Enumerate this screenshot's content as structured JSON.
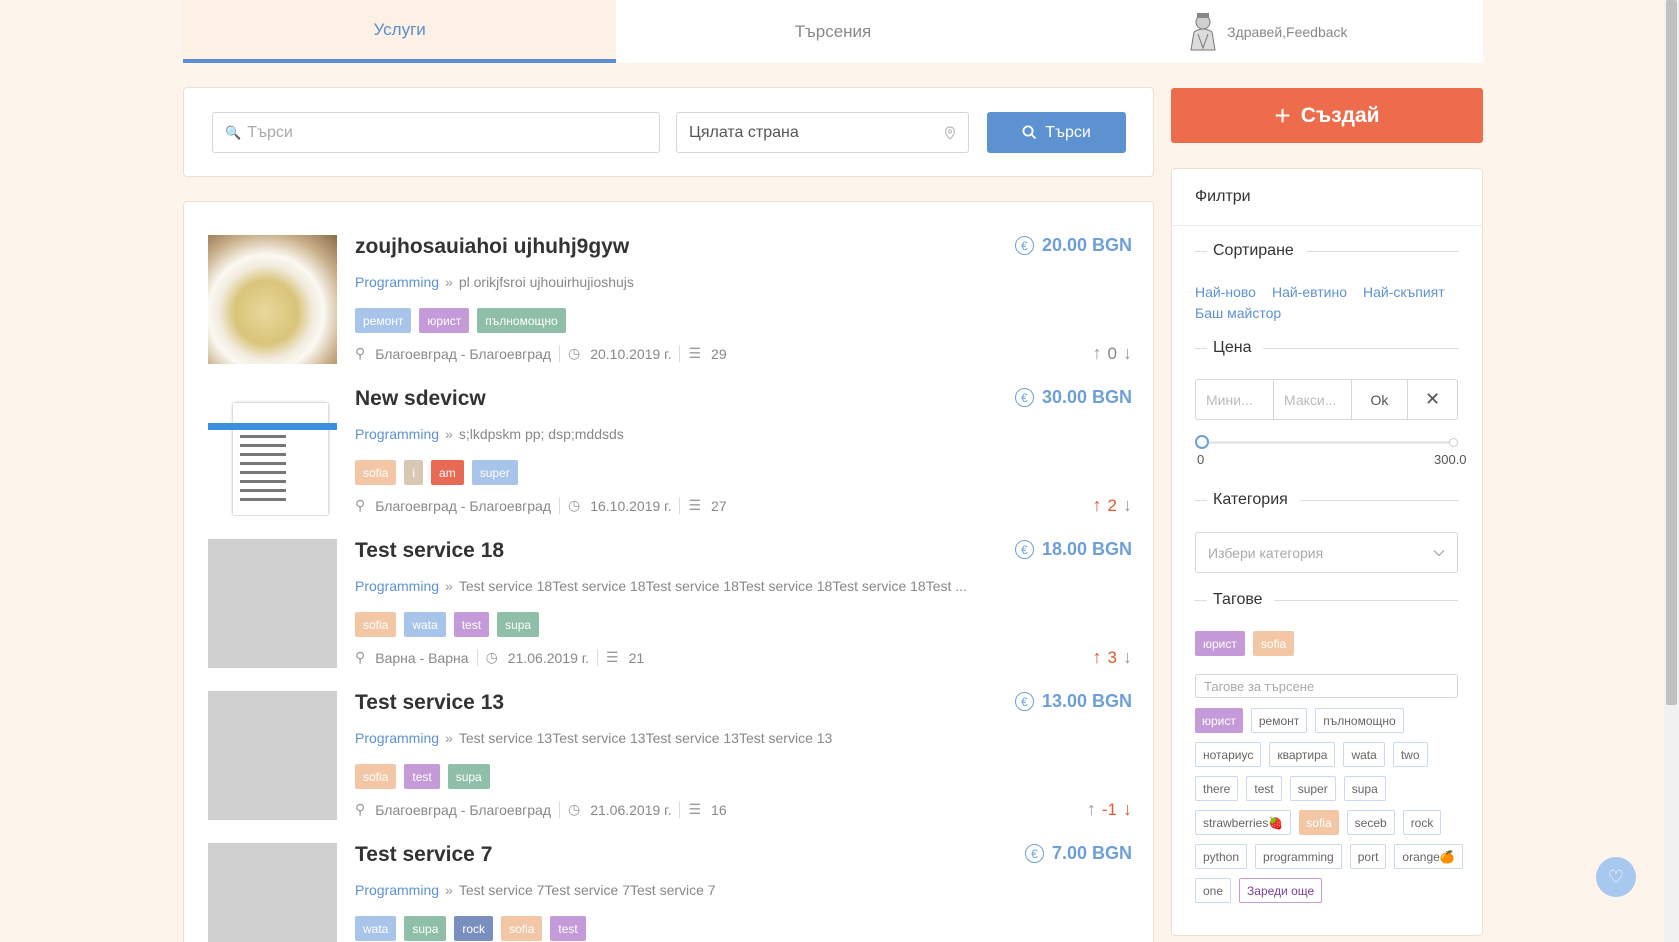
{
  "nav": {
    "tab_services": "Услуги",
    "tab_searches": "Търсения",
    "greeting": "Здравей,Feedback"
  },
  "search": {
    "placeholder": "Търси",
    "location": "Цялата страна",
    "button": "Търси"
  },
  "create_button": "Създай",
  "listings": [
    {
      "title": "zoujhosauiahoi ujhuhj9gyw",
      "price": "20.00 BGN",
      "category": "Programming",
      "description": "pl orikjfsroi ujhouirhujioshujs",
      "tags": [
        {
          "label": "ремонт",
          "color": "#a8c4ea"
        },
        {
          "label": "юрист",
          "color": "#c59ad8"
        },
        {
          "label": "пълномощно",
          "color": "#8fbfa8"
        }
      ],
      "location": "Благоевград - Благоевград",
      "date": "20.10.2019 г.",
      "count": "29",
      "votes": "0",
      "vote_state": "none",
      "thumb": "soup"
    },
    {
      "title": "New sdevicw",
      "price": "30.00 BGN",
      "category": "Programming",
      "description": "s;lkdpskm pp; dsp;mddsds",
      "tags": [
        {
          "label": "sofia",
          "color": "#f3c7a6"
        },
        {
          "label": "i",
          "color": "#d9c9b4"
        },
        {
          "label": "am",
          "color": "#e86a55"
        },
        {
          "label": "super",
          "color": "#a8c4ea"
        }
      ],
      "location": "Благоевград - Благоевград",
      "date": "16.10.2019 г.",
      "count": "27",
      "votes": "2",
      "vote_state": "pos",
      "thumb": "doc"
    },
    {
      "title": "Test service 18",
      "price": "18.00 BGN",
      "category": "Programming",
      "description": "Test service 18Test service 18Test service 18Test service 18Test service 18Test ...",
      "tags": [
        {
          "label": "sofia",
          "color": "#f3c7a6"
        },
        {
          "label": "wata",
          "color": "#a8c4ea"
        },
        {
          "label": "test",
          "color": "#c59ad8"
        },
        {
          "label": "supa",
          "color": "#8fbfa8"
        }
      ],
      "location": "Варна - Варна",
      "date": "21.06.2019 г.",
      "count": "21",
      "votes": "3",
      "vote_state": "pos",
      "thumb": "grey"
    },
    {
      "title": "Test service 13",
      "price": "13.00 BGN",
      "category": "Programming",
      "description": "Test service 13Test service 13Test service 13Test service 13",
      "tags": [
        {
          "label": "sofia",
          "color": "#f3c7a6"
        },
        {
          "label": "test",
          "color": "#c59ad8"
        },
        {
          "label": "supa",
          "color": "#8fbfa8"
        }
      ],
      "location": "Благоевград - Благоевград",
      "date": "21.06.2019 г.",
      "count": "16",
      "votes": "-1",
      "vote_state": "neg",
      "thumb": "grey"
    },
    {
      "title": "Test service 7",
      "price": "7.00 BGN",
      "category": "Programming",
      "description": "Test service 7Test service 7Test service 7",
      "tags": [
        {
          "label": "wata",
          "color": "#a8c4ea"
        },
        {
          "label": "supa",
          "color": "#8fbfa8"
        },
        {
          "label": "rock",
          "color": "#7a8fc0"
        },
        {
          "label": "sofia",
          "color": "#f3c7a6"
        },
        {
          "label": "test",
          "color": "#c59ad8"
        }
      ],
      "location": "",
      "date": "",
      "count": "",
      "votes": "",
      "vote_state": "none",
      "thumb": "grey"
    }
  ],
  "filters": {
    "title": "Филтри",
    "sort_title": "Сортиране",
    "sort_options": [
      "Най-ново",
      "Най-евтино",
      "Най-скъпият",
      "Баш майстор"
    ],
    "price_title": "Цена",
    "price_min_placeholder": "Мини...",
    "price_max_placeholder": "Макси...",
    "ok": "Ok",
    "range_min": "0",
    "range_max": "300.0",
    "category_title": "Категория",
    "category_placeholder": "Избери категория",
    "tags_title": "Тагове",
    "selected_tags": [
      {
        "label": "юрист",
        "color": "#c59ad8"
      },
      {
        "label": "sofia",
        "color": "#f3c7a6"
      }
    ],
    "tag_search_placeholder": "Тагове за търсене",
    "tag_cloud": [
      {
        "label": "юрист",
        "filled": "#c59ad8"
      },
      {
        "label": "ремонт"
      },
      {
        "label": "пълномощно"
      },
      {
        "label": "нотариус"
      },
      {
        "label": "квартира"
      },
      {
        "label": "wata"
      },
      {
        "label": "two"
      },
      {
        "label": "there"
      },
      {
        "label": "test"
      },
      {
        "label": "super"
      },
      {
        "label": "supa"
      },
      {
        "label": "strawberries🍓"
      },
      {
        "label": "sofia",
        "filled": "#f3c7a6"
      },
      {
        "label": "seceb"
      },
      {
        "label": "rock"
      },
      {
        "label": "python"
      },
      {
        "label": "programming"
      },
      {
        "label": "port"
      },
      {
        "label": "orange🍊"
      },
      {
        "label": "one"
      }
    ],
    "load_more": "Зареди още"
  }
}
